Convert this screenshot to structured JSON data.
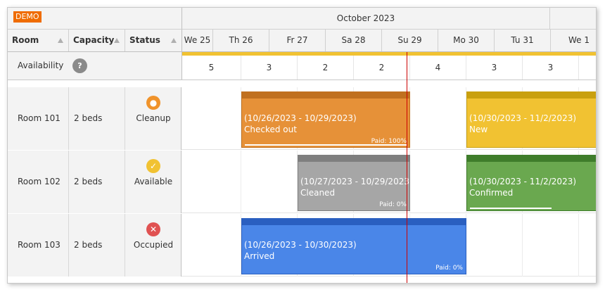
{
  "badge": "DEMO",
  "timeline": {
    "month_label": "October 2023",
    "days": [
      "We 25",
      "Th 26",
      "Fr 27",
      "Sa 28",
      "Su 29",
      "Mo 30",
      "Tu 31",
      "We 1"
    ]
  },
  "columns": {
    "room": "Room",
    "capacity": "Capacity",
    "status": "Status"
  },
  "availability": {
    "label": "Availability",
    "help_glyph": "?",
    "values": [
      "5",
      "3",
      "2",
      "2",
      "4",
      "3",
      "3",
      ""
    ]
  },
  "rooms": [
    {
      "name": "Room 101",
      "capacity": "2 beds",
      "status": "Cleanup",
      "status_icon": "person-icon",
      "status_color": "#f0932b",
      "glyph": "👤"
    },
    {
      "name": "Room 102",
      "capacity": "2 beds",
      "status": "Available",
      "status_icon": "check-icon",
      "status_color": "#f1c232",
      "glyph": "✓"
    },
    {
      "name": "Room 103",
      "capacity": "2 beds",
      "status": "Occupied",
      "status_icon": "x-icon",
      "status_color": "#e05252",
      "glyph": "✕"
    }
  ],
  "reservations": [
    {
      "dates": "(10/26/2023 - 10/29/2023)",
      "status": "Checked out",
      "paid": "Paid: 100%",
      "paid_fraction": 1.0,
      "color": "#e69138",
      "bar_color": "#c0701f"
    },
    {
      "dates": "(10/30/2023 - 11/2/2023)",
      "status": "New",
      "paid": "",
      "paid_fraction": 0,
      "color": "#f1c232",
      "bar_color": "#c9a00f"
    },
    {
      "dates": "(10/27/2023 - 10/29/2023)",
      "status": "Cleaned",
      "paid": "Paid: 0%",
      "paid_fraction": 0,
      "color": "#a6a6a6",
      "bar_color": "#7f7f7f"
    },
    {
      "dates": "(10/30/2023 - 11/2/2023)",
      "status": "Confirmed",
      "paid": "",
      "paid_fraction": 0.75,
      "color": "#6aa84f",
      "bar_color": "#3f7d2b"
    },
    {
      "dates": "(10/26/2023 - 10/30/2023)",
      "status": "Arrived",
      "paid": "Paid: 0%",
      "paid_fraction": 0,
      "color": "#4a86e8",
      "bar_color": "#2a5fc0"
    }
  ]
}
